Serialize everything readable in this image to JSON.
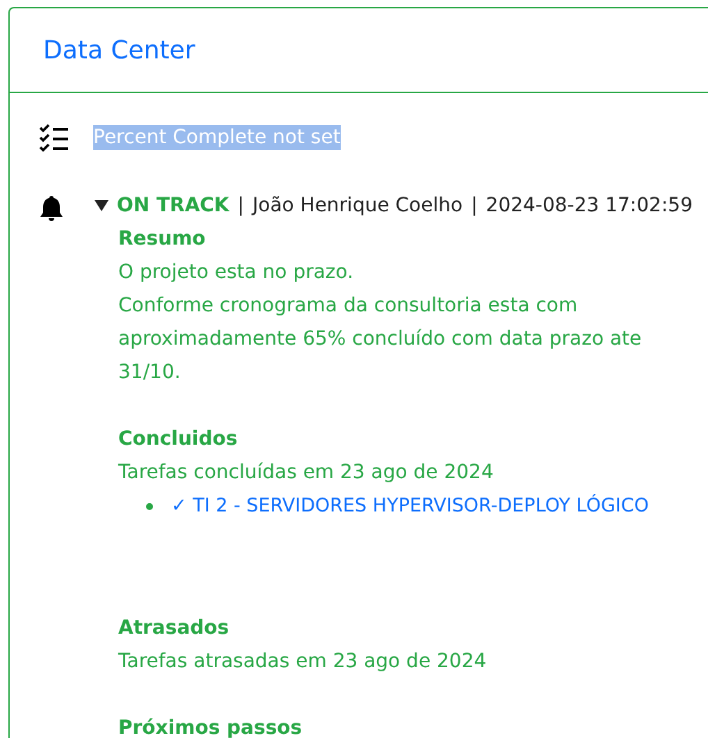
{
  "card": {
    "title": "Data Center"
  },
  "progress": {
    "text": "Percent Complete not set",
    "highlighted": true
  },
  "update": {
    "expanded": true,
    "status": "ON TRACK",
    "separator": "|",
    "author": "João Henrique Coelho",
    "separator_2": "|",
    "timestamp": "2024-08-23 17:02:59",
    "sections": [
      {
        "title": "Resumo",
        "lines": [
          "O projeto esta no prazo.",
          "Conforme cronograma da consultoria esta com aproximadamente 65% concluído com data prazo ate 31/10."
        ]
      },
      {
        "title": "Concluidos",
        "lines": [
          "Tarefas concluídas em 23 ago de 2024"
        ],
        "items": [
          {
            "mark": "✓",
            "text": "TI 2 - SERVIDORES HYPERVISOR-DEPLOY LÓGICO"
          }
        ]
      },
      {
        "title": "Atrasados",
        "lines": [
          "Tarefas atrasadas em 23 ago de 2024"
        ]
      },
      {
        "title": "Próximos passos"
      }
    ]
  }
}
